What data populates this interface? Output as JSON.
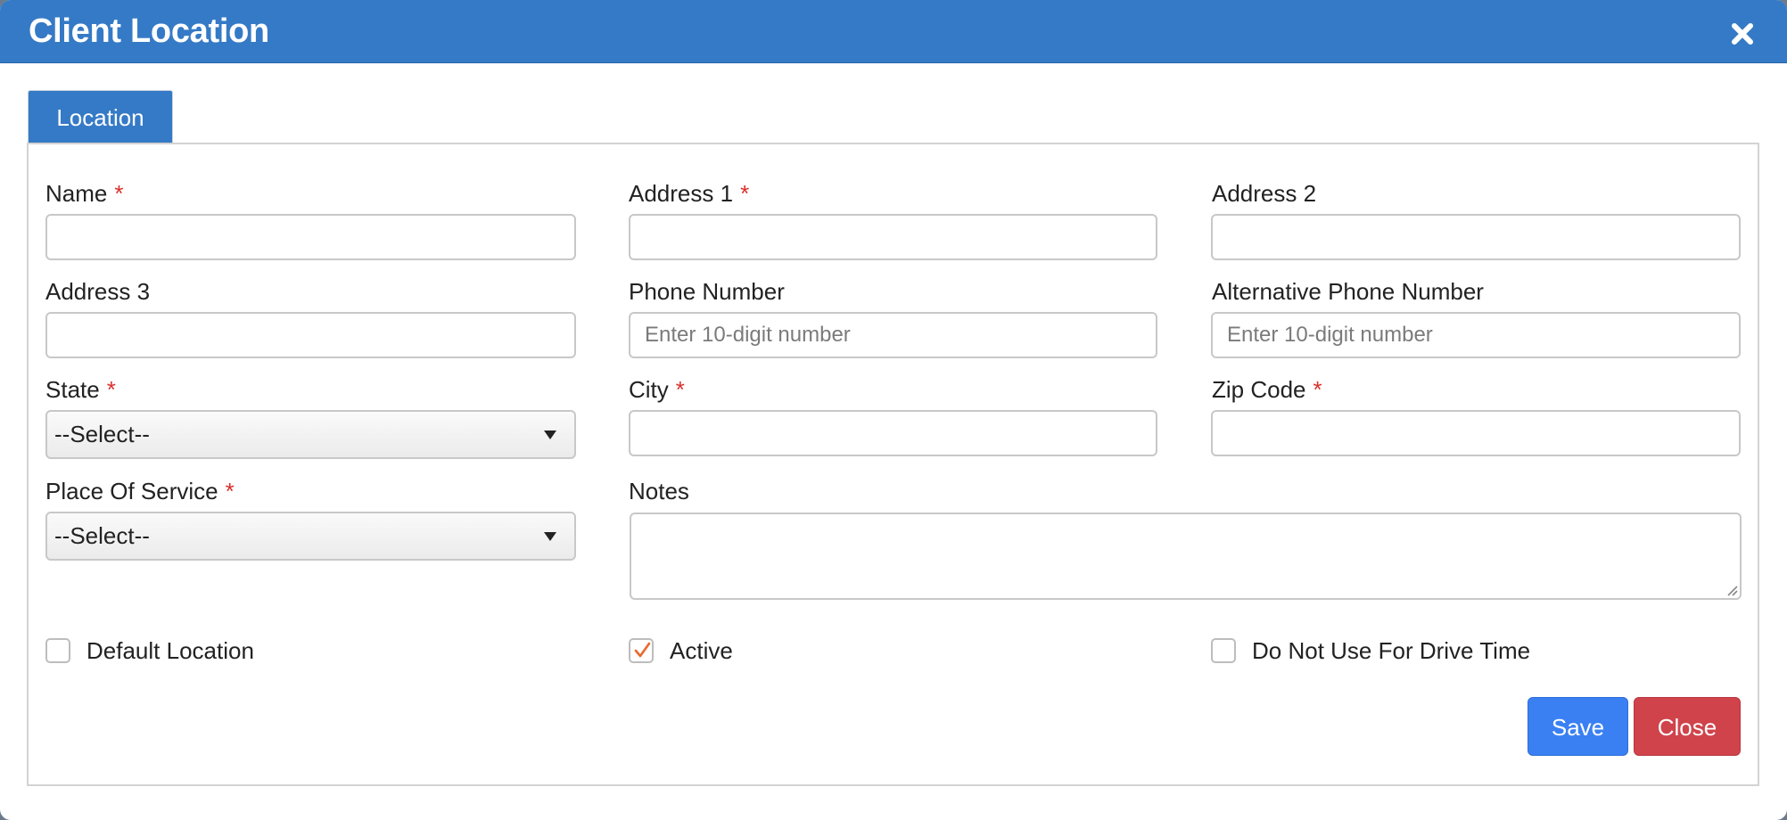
{
  "dialog": {
    "title": "Client Location",
    "close_icon": "close-icon"
  },
  "tabs": [
    {
      "label": "Location",
      "active": true
    }
  ],
  "form": {
    "required_marker": "*",
    "name": {
      "label": "Name",
      "required": true,
      "value": ""
    },
    "address1": {
      "label": "Address 1",
      "required": true,
      "value": ""
    },
    "address2": {
      "label": "Address 2",
      "required": false,
      "value": ""
    },
    "address3": {
      "label": "Address 3",
      "required": false,
      "value": ""
    },
    "phone": {
      "label": "Phone Number",
      "placeholder": "Enter 10-digit number",
      "value": ""
    },
    "alt_phone": {
      "label": "Alternative Phone Number",
      "placeholder": "Enter 10-digit number",
      "value": ""
    },
    "state": {
      "label": "State",
      "required": true,
      "selected": "--Select--"
    },
    "city": {
      "label": "City",
      "required": true,
      "value": ""
    },
    "zip": {
      "label": "Zip Code",
      "required": true,
      "value": ""
    },
    "place_of_service": {
      "label": "Place Of Service",
      "required": true,
      "selected": "--Select--"
    },
    "notes": {
      "label": "Notes",
      "value": ""
    },
    "default_location": {
      "label": "Default Location",
      "checked": false
    },
    "active": {
      "label": "Active",
      "checked": true
    },
    "no_drive_time": {
      "label": "Do Not Use For Drive Time",
      "checked": false
    }
  },
  "buttons": {
    "save": "Save",
    "close": "Close"
  },
  "colors": {
    "header": "#357ac6",
    "save": "#3a80f3",
    "close": "#d0434b",
    "required": "#d9302c",
    "checkmark": "#e8692c"
  }
}
